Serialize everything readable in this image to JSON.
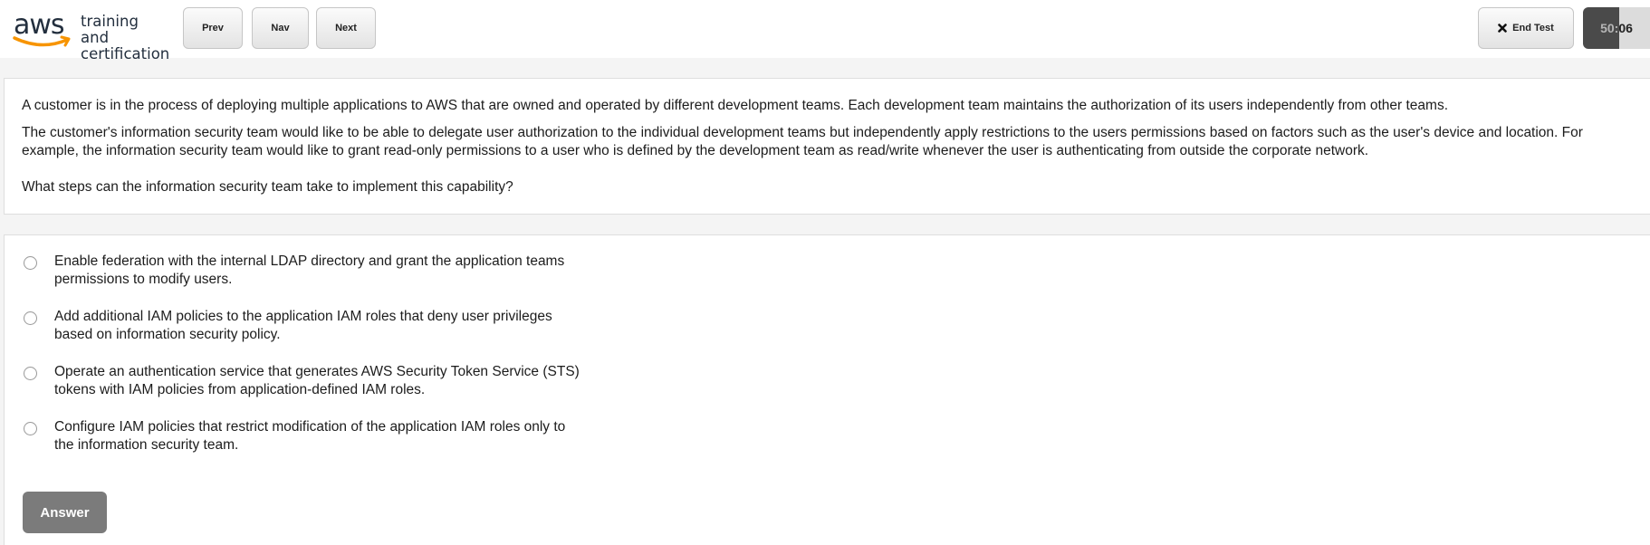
{
  "header": {
    "logo": {
      "wordmark": "aws",
      "text_line1": "training and",
      "text_line2": "certification",
      "smile_color": "#f79400",
      "wordmark_color": "#232f3e"
    },
    "nav": {
      "prev_label": "Prev",
      "nav_label": "Nav",
      "next_label": "Next"
    },
    "end_test": {
      "icon": "close-x-icon",
      "label": "End Test"
    },
    "timer": {
      "value": "50:06"
    }
  },
  "question": {
    "paragraphs": [
      "A customer is in the process of deploying multiple applications to AWS that are owned and operated by different development teams. Each development team maintains the authorization of its users independently from other teams.",
      "The customer's information security team would like to be able to delegate user authorization to the individual development teams but independently apply restrictions to the users permissions based on factors such as the user's device and location. For example, the information security team would like to grant read-only permissions to a user who is defined by the development team as read/write whenever the user is authenticating from outside the corporate network.",
      "What steps can the information security team take to implement this capability?"
    ]
  },
  "options": [
    {
      "label": "Enable federation with the internal LDAP directory and grant the application teams permissions to modify users.",
      "selected": false
    },
    {
      "label": "Add additional IAM policies to the application IAM roles that deny user privileges based on information security policy.",
      "selected": false
    },
    {
      "label": "Operate an authentication service that generates AWS Security Token Service (STS) tokens with IAM policies from application-defined IAM roles.",
      "selected": false
    },
    {
      "label": "Configure IAM policies that restrict modification of the application IAM roles only to the information security team.",
      "selected": false
    }
  ],
  "answer_button": {
    "label": "Answer"
  },
  "colors": {
    "answer_button_bg": "#7b7b7b",
    "timer_bg": "#4a4a4a",
    "page_bg": "#f4f4f4"
  }
}
